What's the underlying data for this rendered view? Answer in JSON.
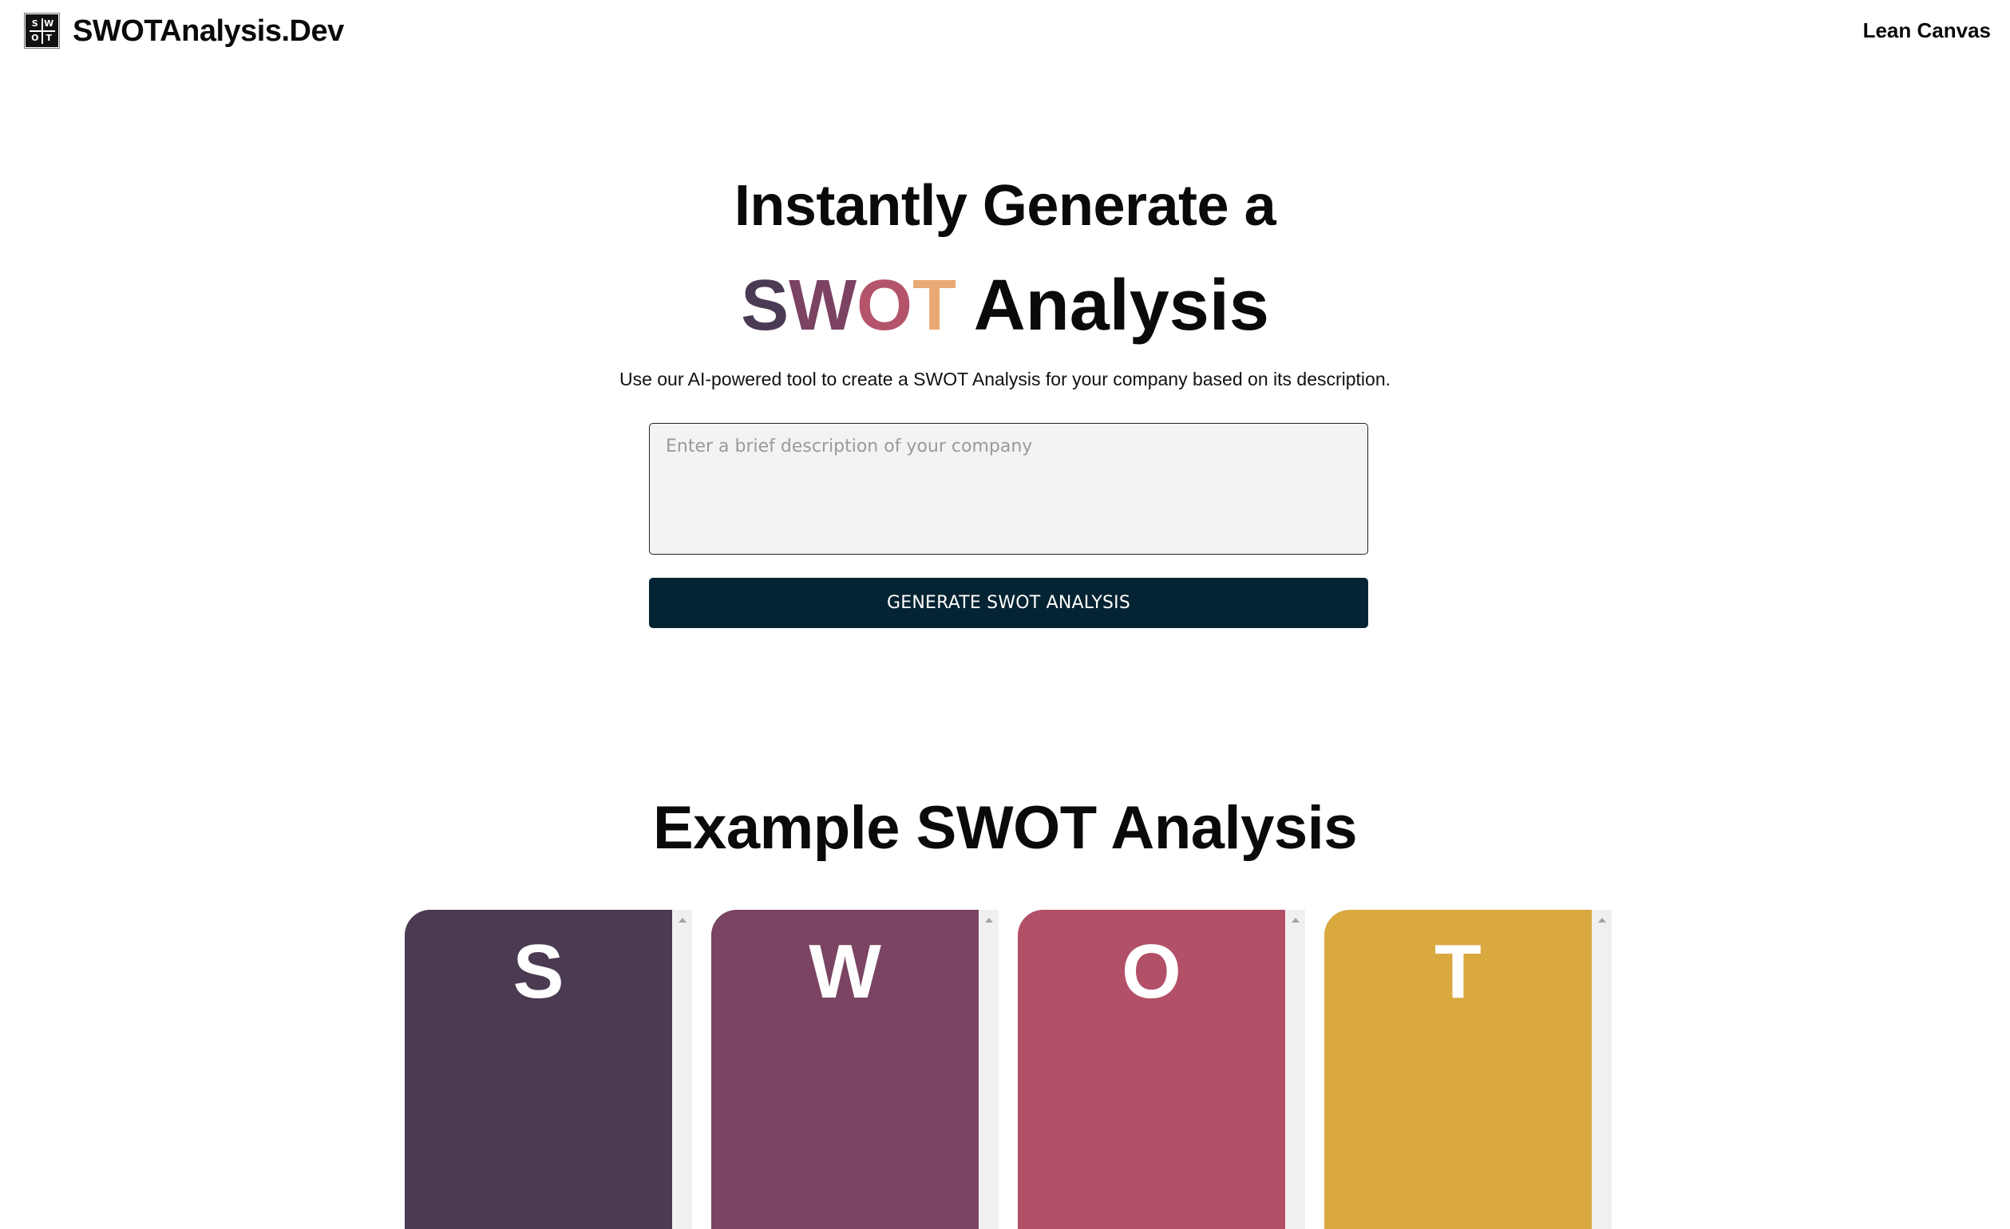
{
  "header": {
    "brand": "SWOTAnalysis.Dev",
    "logo_letters": [
      "S",
      "W",
      "O",
      "T"
    ],
    "nav_link": "Lean Canvas"
  },
  "hero": {
    "title_line1": "Instantly Generate a",
    "title_swot_letters": [
      {
        "char": "S",
        "color": "#4a3a54"
      },
      {
        "char": "W",
        "color": "#7b4262"
      },
      {
        "char": "O",
        "color": "#b4546a"
      },
      {
        "char": "T",
        "color": "#e8a974"
      }
    ],
    "title_line2_suffix": "Analysis",
    "subtitle": "Use our AI-powered tool to create a SWOT Analysis for your company based on its description.",
    "input": {
      "value": "",
      "placeholder": "Enter a brief description of your company"
    },
    "generate_button": "GENERATE SWOT ANALYSIS"
  },
  "example": {
    "title": "Example SWOT Analysis",
    "cards": [
      {
        "letter": "S",
        "color": "#4a3a52"
      },
      {
        "letter": "W",
        "color": "#7a4462"
      },
      {
        "letter": "O",
        "color": "#b25067"
      },
      {
        "letter": "T",
        "color": "#d9a83f"
      }
    ]
  }
}
